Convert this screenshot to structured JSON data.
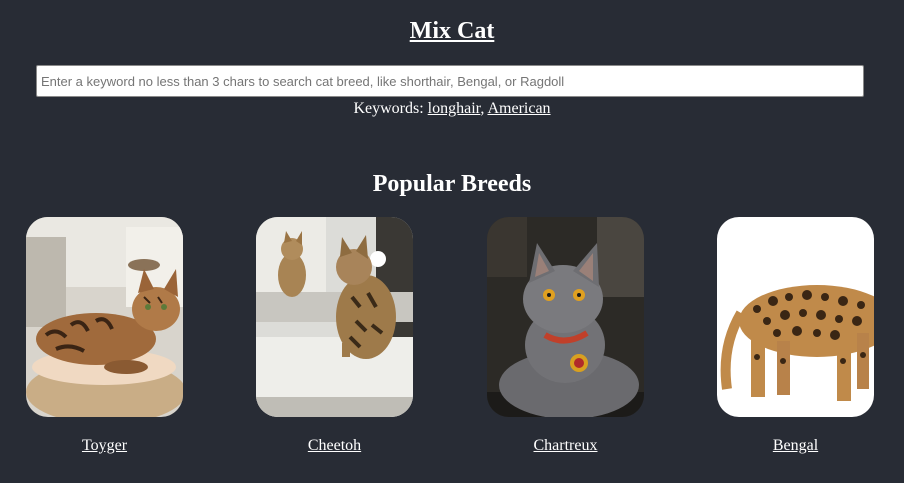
{
  "app": {
    "title": "Mix Cat"
  },
  "search": {
    "value": "",
    "placeholder": "Enter a keyword no less than 3 chars to search cat breed, like shorthair, Bengal, or Ragdoll"
  },
  "keywords": {
    "label": "Keywords:",
    "separator": ",",
    "items": [
      "longhair",
      "American"
    ]
  },
  "popular": {
    "heading": "Popular Breeds",
    "breeds": [
      {
        "name": "Toyger",
        "photo": "toyger-cat-photo"
      },
      {
        "name": "Cheetoh",
        "photo": "cheetoh-cat-photo"
      },
      {
        "name": "Chartreux",
        "photo": "chartreux-cat-photo"
      },
      {
        "name": "Bengal",
        "photo": "bengal-cat-photo"
      }
    ]
  },
  "colors": {
    "background": "#282c35",
    "text": "#ffffff"
  }
}
